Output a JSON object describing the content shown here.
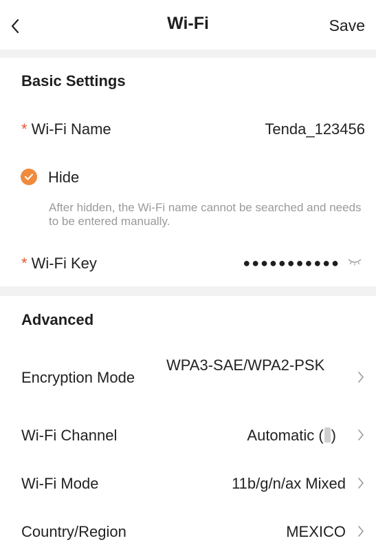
{
  "header": {
    "title": "Wi-Fi",
    "save_label": "Save"
  },
  "basic": {
    "section_title": "Basic Settings",
    "wifi_name_label": "Wi-Fi Name",
    "wifi_name_value": "Tenda_123456",
    "hide_label": "Hide",
    "hide_checked": true,
    "hide_hint": "After hidden, the Wi-Fi name cannot be searched and needs to be entered manually.",
    "wifi_key_label": "Wi-Fi Key",
    "wifi_key_masked": "●●●●●●●●●●●",
    "required_mark": "*"
  },
  "advanced": {
    "section_title": "Advanced",
    "encryption_label": "Encryption Mode",
    "encryption_value": "WPA3-SAE/WPA2-PSK",
    "channel_label": "Wi-Fi Channel",
    "channel_value": "Automatic (",
    "channel_suffix": ")",
    "mode_label": "Wi-Fi Mode",
    "mode_value": "11b/g/n/ax Mixed",
    "country_label": "Country/Region",
    "country_value": "MEXICO"
  },
  "colors": {
    "accent": "#f08a3c",
    "required": "#e8532f",
    "hint": "#9a9a9a",
    "divider": "#f2f2f2"
  }
}
